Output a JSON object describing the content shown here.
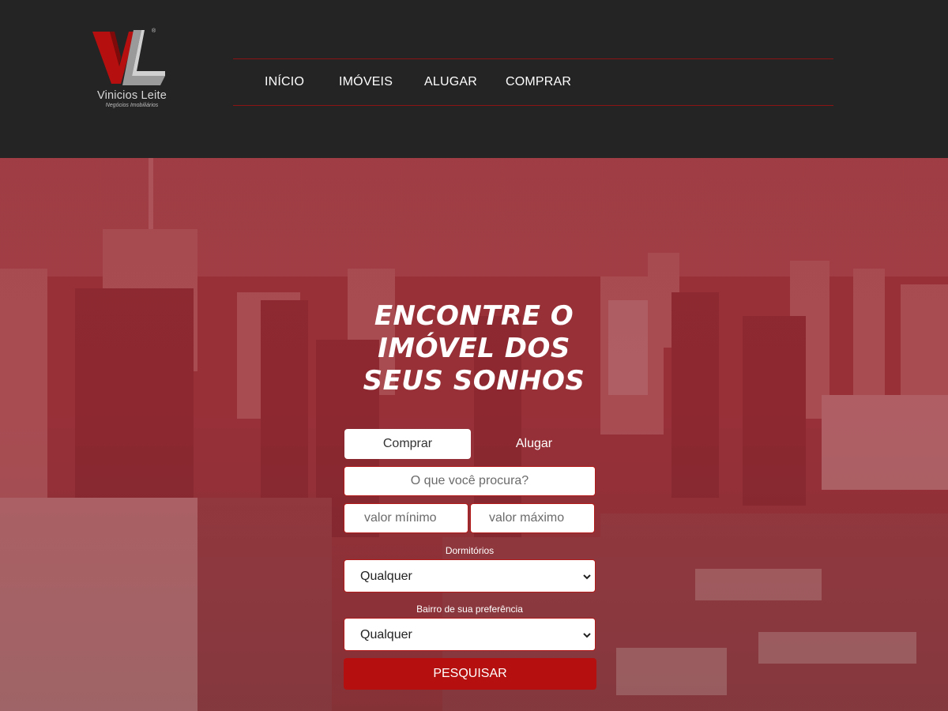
{
  "brand": {
    "name": "Vinicios Leite",
    "tagline": "Negócios Imobiliários",
    "registered": "®",
    "colors": {
      "red": "#b5100f",
      "dark": "#242424",
      "line": "#8b1313"
    }
  },
  "nav": {
    "items": [
      {
        "label": "INÍCIO"
      },
      {
        "label": "IMÓVEIS"
      },
      {
        "label": "ALUGAR"
      },
      {
        "label": "COMPRAR"
      }
    ]
  },
  "hero": {
    "headline_lines": [
      "ENCONTRE O",
      "IMÓVEL DOS",
      "SEUS SONHOS"
    ]
  },
  "search": {
    "tabs": [
      {
        "label": "Comprar",
        "active": true
      },
      {
        "label": "Alugar",
        "active": false
      }
    ],
    "query_placeholder": "O que você procura?",
    "min_placeholder": "valor mínimo",
    "max_placeholder": "valor máximo",
    "dorm_label": "Dormitórios",
    "dorm_value": "Qualquer",
    "bairro_label": "Bairro de sua preferência",
    "bairro_value": "Qualquer",
    "submit_label": "PESQUISAR"
  },
  "icons": {
    "select_arrow": "chevron-down-icon"
  }
}
